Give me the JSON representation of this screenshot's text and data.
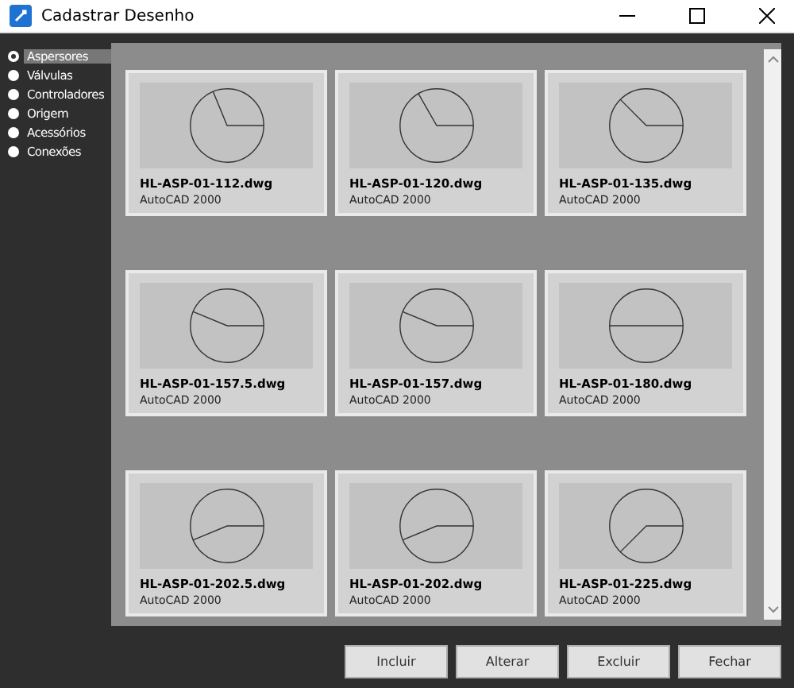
{
  "window": {
    "title": "Cadastrar Desenho"
  },
  "categories": [
    {
      "label": "Aspersores",
      "selected": true
    },
    {
      "label": "Válvulas",
      "selected": false
    },
    {
      "label": "Controladores",
      "selected": false
    },
    {
      "label": "Origem",
      "selected": false
    },
    {
      "label": "Acessórios",
      "selected": false
    },
    {
      "label": "Conexões",
      "selected": false
    }
  ],
  "drawings": [
    {
      "name": "HL-ASP-01-112.dwg",
      "format": "AutoCAD 2000",
      "kind": "sweep112"
    },
    {
      "name": "HL-ASP-01-120.dwg",
      "format": "AutoCAD 2000",
      "kind": "sweep120"
    },
    {
      "name": "HL-ASP-01-135.dwg",
      "format": "AutoCAD 2000",
      "kind": "sweep135"
    },
    {
      "name": "HL-ASP-01-157.5.dwg",
      "format": "AutoCAD 2000",
      "kind": "sweep157"
    },
    {
      "name": "HL-ASP-01-157.dwg",
      "format": "AutoCAD 2000",
      "kind": "sweep157"
    },
    {
      "name": "HL-ASP-01-180.dwg",
      "format": "AutoCAD 2000",
      "kind": "sweep180"
    },
    {
      "name": "HL-ASP-01-202.5.dwg",
      "format": "AutoCAD 2000",
      "kind": "sweep202"
    },
    {
      "name": "HL-ASP-01-202.dwg",
      "format": "AutoCAD 2000",
      "kind": "sweep202"
    },
    {
      "name": "HL-ASP-01-225.dwg",
      "format": "AutoCAD 2000",
      "kind": "sweep225"
    }
  ],
  "buttons": [
    "Incluir",
    "Alterar",
    "Excluir",
    "Fechar"
  ]
}
